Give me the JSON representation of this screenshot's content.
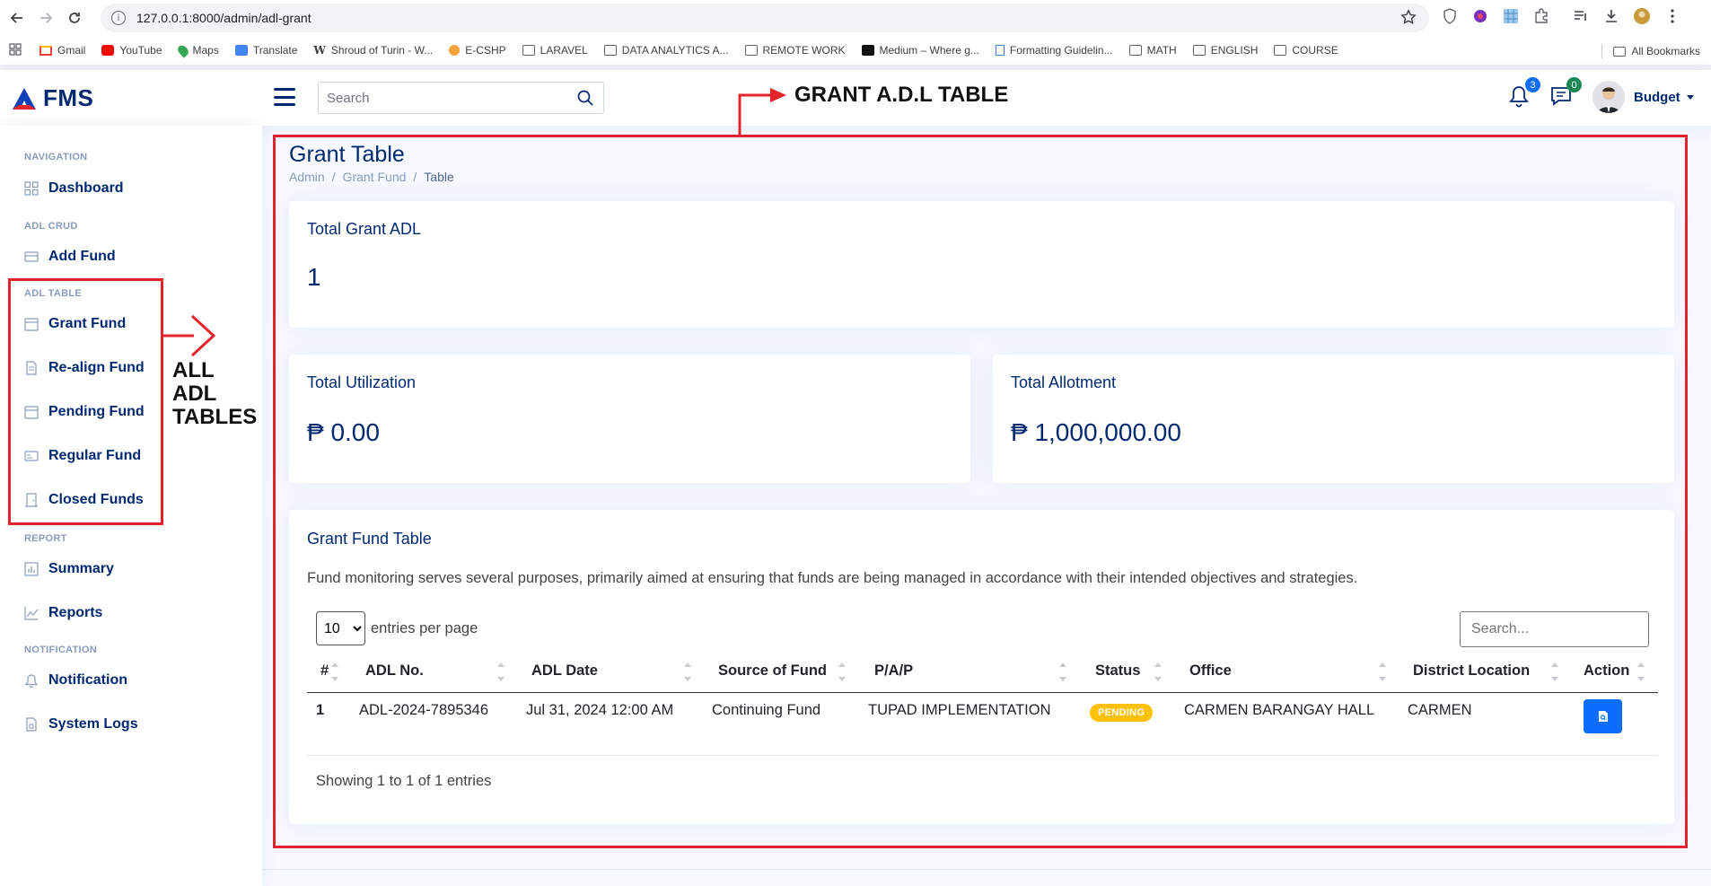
{
  "browser": {
    "url": "127.0.0.1:8000/admin/adl-grant",
    "bookmarks": [
      "Gmail",
      "YouTube",
      "Maps",
      "Translate",
      "Shroud of Turin - W...",
      "E-CSHP",
      "LARAVEL",
      "DATA ANALYTICS A...",
      "REMOTE WORK",
      "Medium – Where g...",
      "Formatting Guidelin...",
      "MATH",
      "ENGLISH",
      "COURSE"
    ],
    "all_bookmarks": "All Bookmarks"
  },
  "app": {
    "logo_text": "FMS",
    "search_placeholder": "Search",
    "notifications_count": "3",
    "messages_count": "0",
    "profile_name": "Budget"
  },
  "sidebar": {
    "heading_navigation": "NAVIGATION",
    "dashboard": "Dashboard",
    "heading_adl_crud": "ADL CRUD",
    "add_fund": "Add Fund",
    "heading_adl_table": "ADL TABLE",
    "grant_fund": "Grant Fund",
    "realign_fund": "Re-align Fund",
    "pending_fund": "Pending Fund",
    "regular_fund": "Regular Fund",
    "closed_funds": "Closed Funds",
    "heading_report": "REPORT",
    "summary": "Summary",
    "reports": "Reports",
    "heading_notification": "NOTIFICATION",
    "notification": "Notification",
    "system_logs": "System Logs"
  },
  "page": {
    "title": "Grant Table",
    "breadcrumb": [
      "Admin",
      "/",
      "Grant Fund",
      "/",
      "Table"
    ]
  },
  "cards": {
    "total_grant_title": "Total Grant ADL",
    "total_grant_value": "1",
    "utilization_title": "Total Utilization",
    "utilization_value": "₱ 0.00",
    "allotment_title": "Total Allotment",
    "allotment_value": "₱ 1,000,000.00"
  },
  "table": {
    "title": "Grant Fund Table",
    "description": "Fund monitoring serves several purposes, primarily aimed at ensuring that funds are being managed in accordance with their intended objectives and strategies.",
    "per_page_value": "10",
    "per_page_label": "entries per page",
    "search_placeholder": "Search...",
    "headers": [
      "#",
      "ADL No.",
      "ADL Date",
      "Source of Fund",
      "P/A/P",
      "Status",
      "Office",
      "District Location",
      "Action"
    ],
    "rows": [
      {
        "num": "1",
        "adl_no": "ADL-2024-7895346",
        "adl_date": "Jul 31, 2024 12:00 AM",
        "source": "Continuing Fund",
        "pap": "TUPAD IMPLEMENTATION",
        "status": "PENDING",
        "office": "CARMEN BARANGAY HALL",
        "district": "CARMEN"
      }
    ],
    "showing": "Showing 1 to 1 of 1 entries"
  },
  "annotations": {
    "grant_label": "GRANT A.D.L TABLE",
    "all_tables_label": [
      "ALL",
      "ADL",
      "TABLES"
    ]
  },
  "colors": {
    "primary": "#012970",
    "accent_blue": "#0d6efd",
    "pending": "#ffc107",
    "annotation_red": "#e3242b",
    "messages_badge": "#198754"
  }
}
